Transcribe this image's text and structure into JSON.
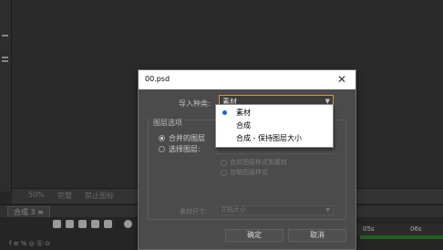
{
  "app": {
    "viewer_bar": {
      "zoom": "50%",
      "resolution": "完整",
      "guides": "禁止图标"
    },
    "timeline_tab": "合成 3 ≡",
    "ruler_labels": [
      "05s",
      "06s"
    ],
    "layer_row": "f ≡ % ◎ Ⓖ ⊙"
  },
  "dialog": {
    "title": "00.psd",
    "close_symbol": "✕",
    "import_kind_label": "导入种类:",
    "import_kind_value": "素材",
    "layer_options_label": "图层选项",
    "merged_layers": "合并的图层",
    "choose_layer": "选择图层:",
    "merge_layer_styles": "合并图层样式到素材",
    "ignore_layer_styles": "忽略图层样式",
    "footage_dimensions_label": "素材尺寸:",
    "footage_dimensions_value": "文档大小",
    "ok": "确定",
    "cancel": "取消"
  },
  "dropdown": {
    "options": [
      "素材",
      "合成",
      "合成 - 保持图层大小"
    ],
    "selected_index": 0
  },
  "colors": {
    "accent_border": "#c79b4a",
    "selection_dot": "#1e66c8",
    "dialog_bg": "#4b4b4b"
  }
}
